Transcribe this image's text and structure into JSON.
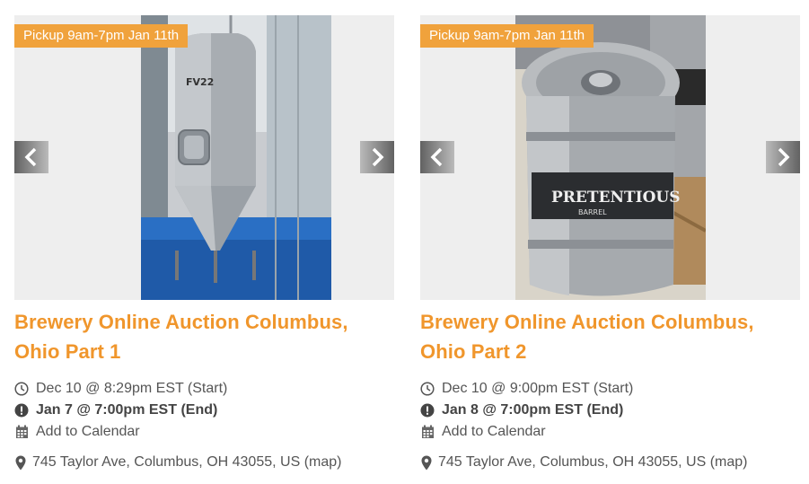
{
  "cards": [
    {
      "badge": "Pickup 9am-7pm Jan 11th",
      "title": "Brewery Online Auction Columbus, Ohio Part 1",
      "start": "Dec 10 @ 8:29pm EST (Start)",
      "end": "Jan 7 @ 7:00pm EST (End)",
      "calendar": "Add to Calendar",
      "address": "745 Taylor Ave, Columbus, OH 43055, US",
      "map": "(map)",
      "tank_label": "FV22"
    },
    {
      "badge": "Pickup 9am-7pm Jan 11th",
      "title": "Brewery Online Auction Columbus, Ohio Part 2",
      "start": "Dec 10 @ 9:00pm EST (Start)",
      "end": "Jan 8 @ 7:00pm EST (End)",
      "calendar": "Add to Calendar",
      "address": "745 Taylor Ave, Columbus, OH 43055, US",
      "map": "(map)",
      "keg_label": "PRETENTIOUS",
      "keg_sub": "BARREL"
    }
  ],
  "colors": {
    "accent": "#f0962c",
    "badge": "#f0a23c",
    "text": "#555555"
  },
  "icons": [
    "clock-icon",
    "alert-circle-icon",
    "calendar-icon",
    "map-pin-icon",
    "chevron-left-icon",
    "chevron-right-icon"
  ]
}
